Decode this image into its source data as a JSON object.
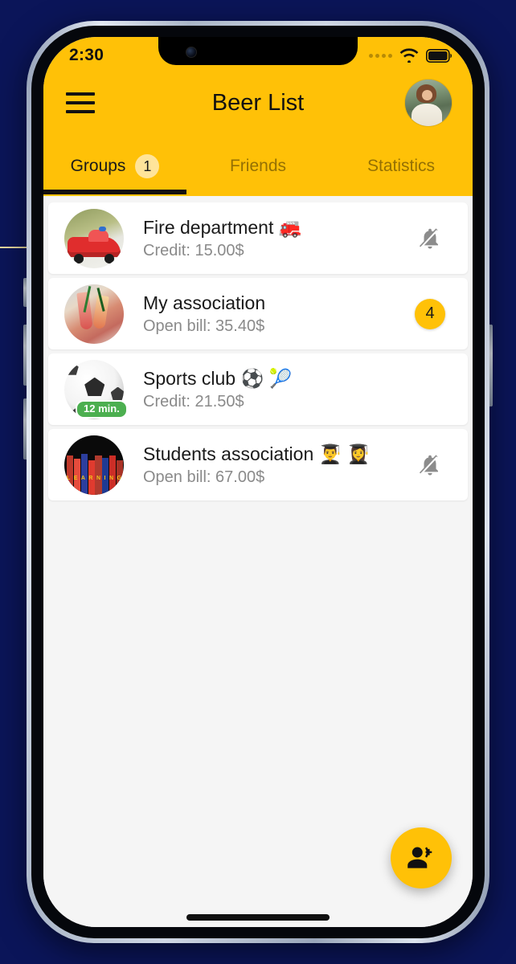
{
  "theme": {
    "accent_yellow": "#FFC107",
    "badge_light_yellow": "#FFE49A",
    "page_background": "#0b1559",
    "list_background": "#f5f5f5",
    "card_background": "#ffffff",
    "time_pill_green": "#4CAF50"
  },
  "status_bar": {
    "time": "2:30",
    "signal_icon": "signal-dots-icon",
    "wifi_icon": "wifi-icon",
    "battery_icon": "battery-full-icon"
  },
  "header": {
    "menu_icon": "hamburger-menu-icon",
    "title": "Beer List",
    "avatar_icon": "user-avatar-photo"
  },
  "tabs": [
    {
      "label": "Groups",
      "badge": "1",
      "active": true
    },
    {
      "label": "Friends",
      "badge": "",
      "active": false
    },
    {
      "label": "Statistics",
      "badge": "",
      "active": false
    }
  ],
  "groups": [
    {
      "title": "Fire department 🚒",
      "subtitle": "Credit: 15.00$",
      "avatar": "fire-truck-photo",
      "right_icon": "bell-off-icon",
      "right_badge": "",
      "time_pill": ""
    },
    {
      "title": "My association",
      "subtitle": "Open bill: 35.40$",
      "avatar": "cocktails-photo",
      "right_icon": "",
      "right_badge": "4",
      "time_pill": ""
    },
    {
      "title": "Sports club ⚽ 🎾",
      "subtitle": "Credit: 21.50$",
      "avatar": "soccer-ball-photo",
      "right_icon": "",
      "right_badge": "",
      "time_pill": "12 min."
    },
    {
      "title": "Students association 👨‍🎓 👩‍🎓",
      "subtitle": "Open bill: 67.00$",
      "avatar": "books-photo",
      "right_icon": "bell-off-icon",
      "right_badge": "",
      "time_pill": ""
    }
  ],
  "fab": {
    "icon": "add-group-icon",
    "label": ""
  },
  "book_glyphs": [
    "L",
    "E",
    "A",
    "R",
    "N",
    "I",
    "N",
    "G"
  ]
}
